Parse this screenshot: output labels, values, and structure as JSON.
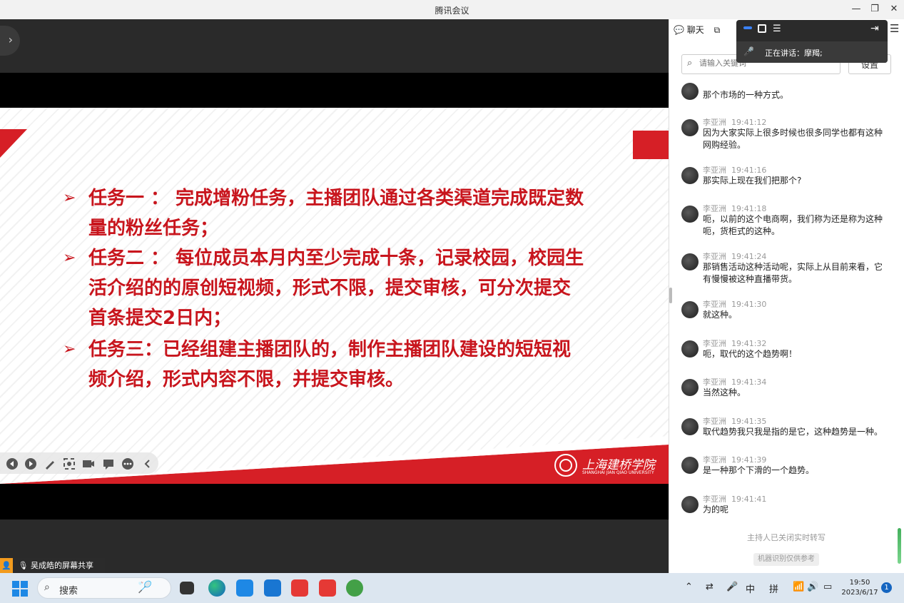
{
  "window": {
    "title": "腾讯会议"
  },
  "share": {
    "label": "吴成皓的屏幕共享"
  },
  "slide": {
    "tasks": [
      {
        "line1": "任务一 ： 完成增粉任务，主播团队通过各类渠道完成既定数",
        "line2": "量的粉丝任务；"
      },
      {
        "line1": "任务二 ：  每位成员本月内至少完成十条，记录校园，校园生",
        "line2": "活介绍的的原创短视频，形式不限，提交审核，可分次提交",
        "line3": "首条提交2日内；"
      },
      {
        "line1": "任务三：已经组建主播团队的，制作主播团队建设的短短视",
        "line2": "频介绍，形式内容不限，并提交审核。"
      }
    ],
    "logo": {
      "name": "上海建桥学院",
      "sub": "SHANGHAI JIAN QIAO UNIVERSITY"
    }
  },
  "chat": {
    "tab_label": "聊天",
    "search_placeholder": "请输入关键词",
    "settings_label": "设置",
    "speaking": "正在讲话：摩羯;",
    "first_partial": "那个市场的一种方式。",
    "messages": [
      {
        "name": "李亚洲",
        "time": "19:41:12",
        "text": "因为大家实际上很多时候也很多同学也都有这种网购经验。"
      },
      {
        "name": "李亚洲",
        "time": "19:41:16",
        "text": "那实际上现在我们把那个?"
      },
      {
        "name": "李亚洲",
        "time": "19:41:18",
        "text": "呃，以前的这个电商啊，我们称为还是称为这种呃，货柜式的这种。"
      },
      {
        "name": "李亚洲",
        "time": "19:41:24",
        "text": "那销售活动这种活动呢，实际上从目前来看，它有慢慢被这种直播带货。"
      },
      {
        "name": "李亚洲",
        "time": "19:41:30",
        "text": "就这种。"
      },
      {
        "name": "李亚洲",
        "time": "19:41:32",
        "text": "呃，取代的这个趋势啊！"
      },
      {
        "name": "李亚洲",
        "time": "19:41:34",
        "text": "当然这种。"
      },
      {
        "name": "李亚洲",
        "time": "19:41:35",
        "text": "取代趋势我只我是指的是它，这种趋势是一种。"
      },
      {
        "name": "李亚洲",
        "time": "19:41:39",
        "text": "是一种那个下滑的一个趋势。"
      },
      {
        "name": "李亚洲",
        "time": "19:41:41",
        "text": "为的呢"
      }
    ],
    "host_note": "主持人已关闭实时转写",
    "machine_note": "机器识别仅供参考"
  },
  "taskbar": {
    "search_label": "搜索",
    "tray": {
      "ime1": "中",
      "ime2": "拼"
    },
    "clock_time": "19:50",
    "clock_date": "2023/6/17",
    "notif_count": "1"
  },
  "colors": {
    "slide_red": "#d61f26",
    "task_text": "#c8151d",
    "accent_blue": "#1565c0"
  }
}
